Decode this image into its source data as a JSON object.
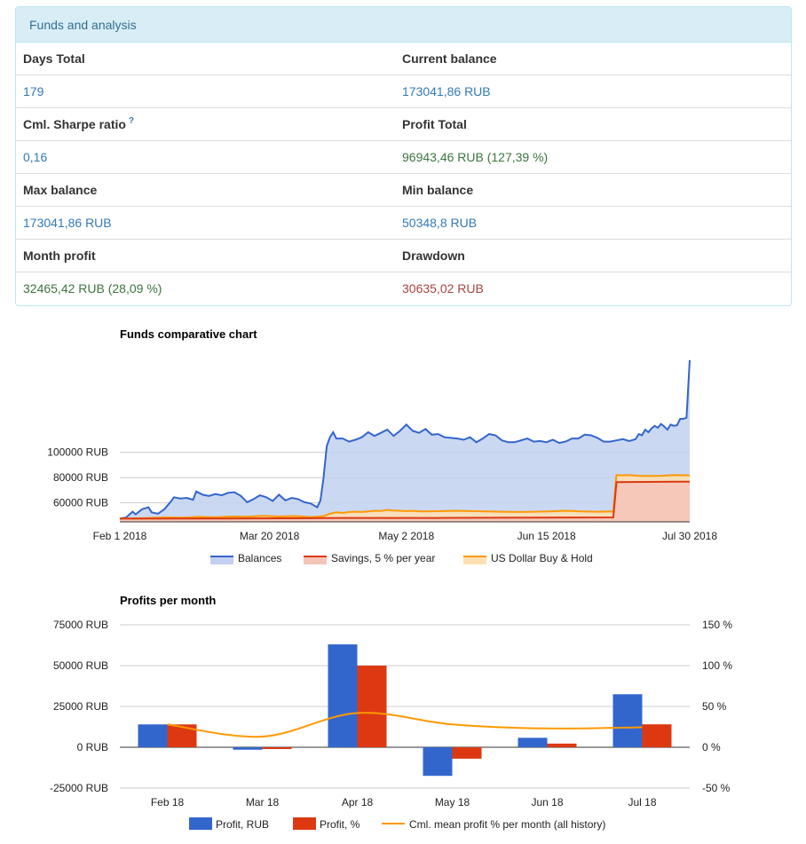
{
  "panel": {
    "title": "Funds and analysis"
  },
  "stats": [
    {
      "label": "Days Total",
      "value": "179",
      "tone": "blue",
      "help": ""
    },
    {
      "label": "Current balance",
      "value": "173041,86 RUB",
      "tone": "blue",
      "help": ""
    },
    {
      "label": "Cml. Sharpe ratio",
      "value": "0,16",
      "tone": "blue",
      "help": "?"
    },
    {
      "label": "Profit Total",
      "value": "96943,46 RUB (127,39 %)",
      "tone": "green",
      "help": ""
    },
    {
      "label": "Max balance",
      "value": "173041,86 RUB",
      "tone": "blue",
      "help": ""
    },
    {
      "label": "Min balance",
      "value": "50348,8 RUB",
      "tone": "blue",
      "help": ""
    },
    {
      "label": "Month profit",
      "value": "32465,42 RUB (28,09 %)",
      "tone": "green",
      "help": ""
    },
    {
      "label": "Drawdown",
      "value": "30635,02 RUB",
      "tone": "red",
      "help": ""
    }
  ],
  "colors": {
    "blue": "#3366cc",
    "red": "#dc3912",
    "orange": "#ff9900",
    "text_blue": "#337ab7",
    "text_green": "#3c763d",
    "text_red": "#a94442"
  },
  "chart_data": [
    {
      "type": "area",
      "title": "Funds comparative chart",
      "x_ticks": [
        "Feb 1 2018",
        "Mar 20 2018",
        "May 2 2018",
        "Jun 15 2018",
        "Jul 30 2018"
      ],
      "y_ticks": [
        "60000 RUB",
        "80000 RUB",
        "100000 RUB"
      ],
      "y_tick_values": [
        60000,
        80000,
        100000
      ],
      "ylim": [
        45000,
        175000
      ],
      "x_range_days": [
        0,
        179
      ],
      "grid": true,
      "legend_position": "bottom",
      "series": [
        {
          "name": "Balances",
          "color": "#3366cc",
          "fill": "#c2d1f0",
          "points": [
            [
              0,
              47500
            ],
            [
              2,
              48500
            ],
            [
              4,
              53000
            ],
            [
              5,
              51000
            ],
            [
              7,
              55000
            ],
            [
              9,
              56500
            ],
            [
              10,
              52500
            ],
            [
              12,
              51500
            ],
            [
              14,
              55000
            ],
            [
              16,
              61000
            ],
            [
              17,
              64500
            ],
            [
              19,
              63500
            ],
            [
              21,
              64000
            ],
            [
              23,
              62500
            ],
            [
              24,
              69000
            ],
            [
              26,
              66500
            ],
            [
              28,
              65500
            ],
            [
              30,
              67000
            ],
            [
              32,
              66000
            ],
            [
              34,
              68000
            ],
            [
              36,
              68500
            ],
            [
              38,
              65500
            ],
            [
              40,
              60500
            ],
            [
              42,
              63000
            ],
            [
              44,
              66000
            ],
            [
              46,
              64500
            ],
            [
              48,
              61500
            ],
            [
              50,
              66500
            ],
            [
              52,
              62000
            ],
            [
              54,
              64000
            ],
            [
              56,
              63000
            ],
            [
              58,
              60500
            ],
            [
              60,
              59500
            ],
            [
              62,
              56500
            ],
            [
              63,
              62000
            ],
            [
              64,
              80000
            ],
            [
              65,
              105000
            ],
            [
              66,
              112000
            ],
            [
              67,
              116000
            ],
            [
              68,
              111000
            ],
            [
              70,
              111000
            ],
            [
              72,
              108500
            ],
            [
              74,
              110000
            ],
            [
              76,
              112000
            ],
            [
              78,
              116000
            ],
            [
              80,
              113000
            ],
            [
              82,
              115500
            ],
            [
              84,
              118000
            ],
            [
              86,
              113000
            ],
            [
              88,
              117000
            ],
            [
              90,
              122000
            ],
            [
              92,
              117000
            ],
            [
              94,
              115500
            ],
            [
              96,
              118500
            ],
            [
              98,
              114000
            ],
            [
              100,
              114500
            ],
            [
              102,
              112000
            ],
            [
              104,
              111500
            ],
            [
              106,
              111000
            ],
            [
              108,
              110000
            ],
            [
              110,
              112000
            ],
            [
              112,
              108000
            ],
            [
              114,
              111000
            ],
            [
              116,
              114500
            ],
            [
              118,
              113500
            ],
            [
              120,
              109500
            ],
            [
              122,
              108000
            ],
            [
              124,
              108000
            ],
            [
              126,
              109500
            ],
            [
              128,
              111000
            ],
            [
              130,
              108500
            ],
            [
              132,
              109000
            ],
            [
              134,
              108000
            ],
            [
              136,
              110000
            ],
            [
              138,
              107500
            ],
            [
              140,
              108500
            ],
            [
              142,
              111000
            ],
            [
              144,
              111000
            ],
            [
              146,
              114000
            ],
            [
              148,
              113500
            ],
            [
              150,
              111500
            ],
            [
              152,
              108500
            ],
            [
              154,
              108500
            ],
            [
              156,
              109500
            ],
            [
              158,
              110500
            ],
            [
              160,
              109000
            ],
            [
              162,
              110500
            ],
            [
              163,
              114500
            ],
            [
              164,
              113500
            ],
            [
              165,
              118000
            ],
            [
              166,
              116000
            ],
            [
              167,
              119000
            ],
            [
              168,
              121000
            ],
            [
              169,
              119500
            ],
            [
              170,
              122500
            ],
            [
              171,
              120500
            ],
            [
              172,
              118000
            ],
            [
              173,
              122000
            ],
            [
              174,
              121000
            ],
            [
              175,
              121500
            ],
            [
              176,
              126500
            ],
            [
              177,
              126500
            ],
            [
              178,
              127500
            ],
            [
              179,
              173041.86
            ]
          ]
        },
        {
          "name": "Savings, 5 % per year",
          "color": "#dc3912",
          "fill": "#f5c4b8",
          "points": [
            [
              0,
              47500
            ],
            [
              30,
              47600
            ],
            [
              60,
              47900
            ],
            [
              64,
              48000
            ],
            [
              100,
              48100
            ],
            [
              130,
              48400
            ],
            [
              155,
              48500
            ],
            [
              156,
              76500
            ],
            [
              179,
              76800
            ]
          ]
        },
        {
          "name": "US Dollar Buy & Hold",
          "color": "#ff9900",
          "fill": "#ffe0b2",
          "points": [
            [
              0,
              47500
            ],
            [
              8,
              48000
            ],
            [
              15,
              48500
            ],
            [
              20,
              48300
            ],
            [
              25,
              48900
            ],
            [
              30,
              48600
            ],
            [
              35,
              49200
            ],
            [
              40,
              49000
            ],
            [
              45,
              49800
            ],
            [
              50,
              49200
            ],
            [
              55,
              49600
            ],
            [
              60,
              48800
            ],
            [
              64,
              49500
            ],
            [
              66,
              51500
            ],
            [
              68,
              52500
            ],
            [
              70,
              52000
            ],
            [
              72,
              52800
            ],
            [
              74,
              53000
            ],
            [
              76,
              52800
            ],
            [
              78,
              53200
            ],
            [
              80,
              53800
            ],
            [
              82,
              53600
            ],
            [
              84,
              54500
            ],
            [
              86,
              54000
            ],
            [
              88,
              53800
            ],
            [
              90,
              53500
            ],
            [
              92,
              53700
            ],
            [
              95,
              53200
            ],
            [
              100,
              53400
            ],
            [
              105,
              53800
            ],
            [
              110,
              53500
            ],
            [
              115,
              53300
            ],
            [
              120,
              53000
            ],
            [
              125,
              52800
            ],
            [
              130,
              53000
            ],
            [
              135,
              53200
            ],
            [
              140,
              53800
            ],
            [
              142,
              53600
            ],
            [
              145,
              53200
            ],
            [
              150,
              53000
            ],
            [
              155,
              53200
            ],
            [
              156,
              82000
            ],
            [
              158,
              81800
            ],
            [
              160,
              82000
            ],
            [
              163,
              81500
            ],
            [
              166,
              81300
            ],
            [
              170,
              81500
            ],
            [
              174,
              82000
            ],
            [
              179,
              81800
            ]
          ]
        }
      ]
    },
    {
      "type": "bar",
      "title": "Profits per month",
      "categories": [
        "Feb 18",
        "Mar 18",
        "Apr 18",
        "May 18",
        "Jun 18",
        "Jul 18"
      ],
      "y_ticks": [
        "75000 RUB",
        "50000 RUB",
        "25000 RUB",
        "0 RUB",
        "-25000 RUB"
      ],
      "y_tick_values": [
        75000,
        50000,
        25000,
        0,
        -25000
      ],
      "y2_ticks": [
        "150 %",
        "100 %",
        "50 %",
        "0 %",
        "-50 %"
      ],
      "y2_tick_values": [
        150,
        100,
        50,
        0,
        -50
      ],
      "ylim": [
        -25000,
        75000
      ],
      "y2lim": [
        -50,
        150
      ],
      "grid": true,
      "legend_position": "bottom",
      "series": [
        {
          "name": "Profit, RUB",
          "color": "#3366cc",
          "axis": "left",
          "values": [
            14000,
            -1500,
            63000,
            -17500,
            5800,
            32465.42
          ]
        },
        {
          "name": "Profit, %",
          "color": "#dc3912",
          "axis": "right",
          "values": [
            28,
            -2,
            100,
            -14,
            4.5,
            28.09
          ]
        },
        {
          "name": "Cml. mean profit % per month (all history)",
          "color": "#ff9900",
          "axis": "right",
          "kind": "line",
          "values": [
            28,
            13,
            42,
            28,
            23,
            24.5
          ]
        }
      ]
    }
  ]
}
